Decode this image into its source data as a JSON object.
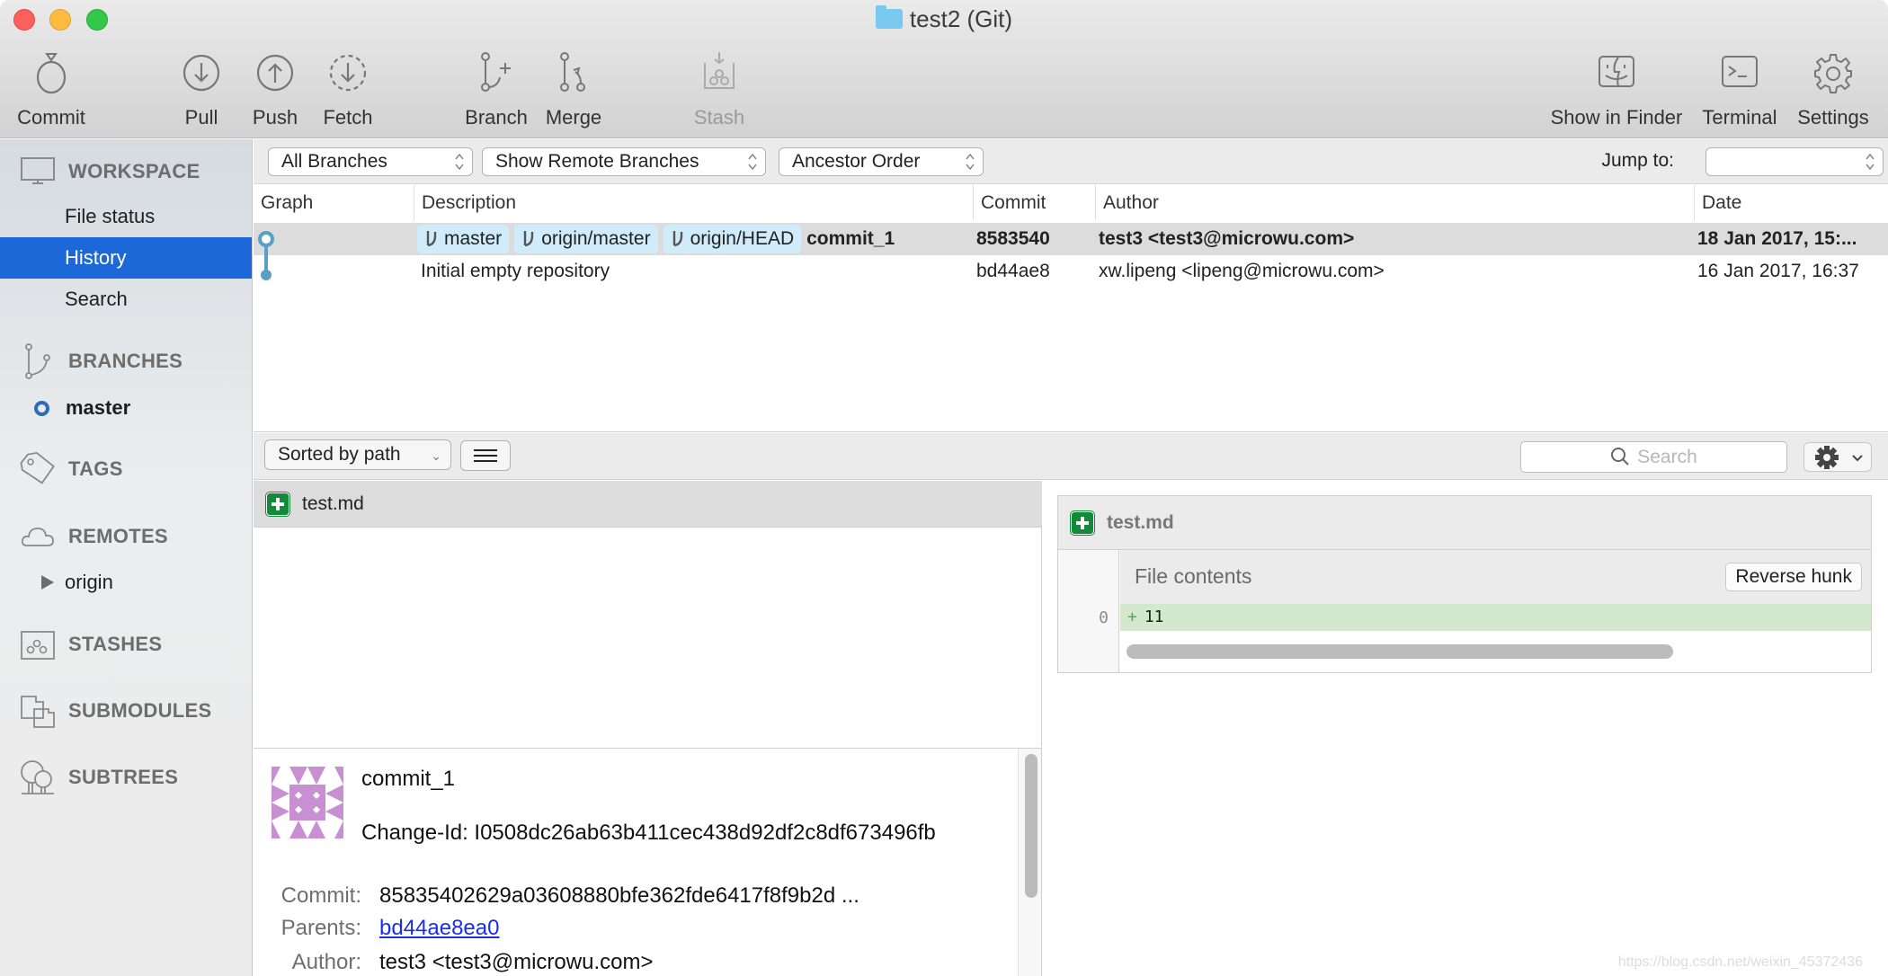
{
  "window": {
    "title": "test2 (Git)"
  },
  "toolbar": {
    "commit": "Commit",
    "pull": "Pull",
    "push": "Push",
    "fetch": "Fetch",
    "branch": "Branch",
    "merge": "Merge",
    "stash": "Stash",
    "show_in_finder": "Show in Finder",
    "terminal": "Terminal",
    "settings": "Settings"
  },
  "sidebar": {
    "workspace": {
      "header": "WORKSPACE",
      "items": [
        {
          "label": "File status",
          "active": false
        },
        {
          "label": "History",
          "active": true
        },
        {
          "label": "Search",
          "active": false
        }
      ]
    },
    "branches": {
      "header": "BRANCHES",
      "items": [
        {
          "label": "master",
          "current": true
        }
      ]
    },
    "tags": {
      "header": "TAGS"
    },
    "remotes": {
      "header": "REMOTES",
      "items": [
        {
          "label": "origin",
          "expanded": false
        }
      ]
    },
    "stashes": {
      "header": "STASHES"
    },
    "submodules": {
      "header": "SUBMODULES"
    },
    "subtrees": {
      "header": "SUBTREES"
    }
  },
  "filters": {
    "branches": "All Branches",
    "remote": "Show Remote Branches",
    "order": "Ancestor Order",
    "jump_to_label": "Jump to:",
    "jump_to_value": ""
  },
  "commit_table": {
    "columns": [
      "Graph",
      "Description",
      "Commit",
      "Author",
      "Date"
    ],
    "rows": [
      {
        "refs": [
          "master",
          "origin/master",
          "origin/HEAD"
        ],
        "description": "commit_1",
        "commit": "8583540",
        "author": "test3 <test3@microwu.com>",
        "date": "18 Jan 2017, 15:...",
        "selected": true
      },
      {
        "refs": [],
        "description": "Initial empty repository",
        "commit": "bd44ae8",
        "author": "xw.lipeng <lipeng@microwu.com>",
        "date": "16 Jan 2017, 16:37",
        "selected": false
      }
    ],
    "graph_color": "#5aa0c4"
  },
  "file_panel": {
    "sort_label": "Sorted by path",
    "search_placeholder": "Search",
    "files": [
      {
        "name": "test.md",
        "status": "added"
      }
    ]
  },
  "diff": {
    "file": "test.md",
    "hunk_title": "File contents",
    "reverse_hunk": "Reverse hunk",
    "lines": [
      {
        "number": "0",
        "prefix": "+",
        "text": "11"
      }
    ]
  },
  "details": {
    "subject": "commit_1",
    "change_id": "Change-Id: I0508dc26ab63b411cec438d92df2c8df673496fb",
    "commit_label": "Commit:",
    "commit_value": "85835402629a03608880bfe362fde6417f8f9b2d ...",
    "parents_label": "Parents:",
    "parents_value": "bd44ae8ea0",
    "author_label": "Author:",
    "author_value": "test3 <test3@microwu.com>"
  },
  "colors": {
    "selection": "#1d68d9",
    "ref_tag": "#d0ecfa",
    "added": "#13893a",
    "avatar": "#c98fd3"
  },
  "watermark": "https://blog.csdn.net/weixin_45372436"
}
